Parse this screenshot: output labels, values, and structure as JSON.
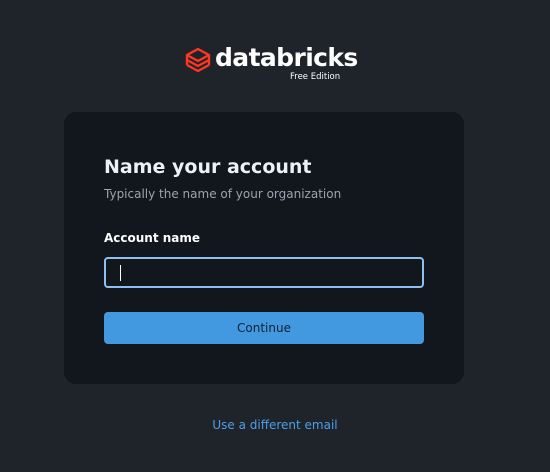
{
  "brand": {
    "wordmark": "databricks",
    "edition": "Free Edition",
    "logo_icon": "databricks-stack-icon",
    "accent_color": "#ff3621"
  },
  "card": {
    "title": "Name your account",
    "subtitle": "Typically the name of your organization",
    "field_label": "Account name",
    "field_value": "",
    "continue_label": "Continue"
  },
  "footer": {
    "link_label": "Use a different email"
  },
  "colors": {
    "background": "#1f232a",
    "card": "#12161d",
    "primary_button": "#4299e0",
    "input_focus_border": "#8fbfee",
    "link": "#4d9fe8"
  }
}
